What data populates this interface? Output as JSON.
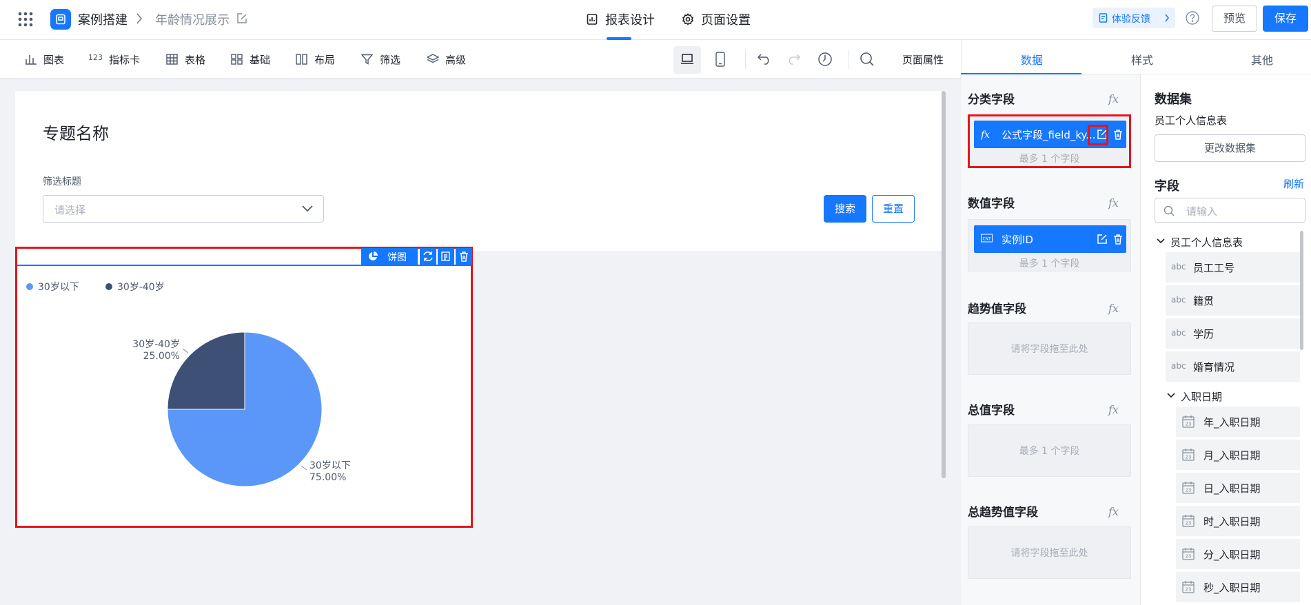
{
  "header": {
    "app_name": "案例搭建",
    "page_name": "年龄情况展示",
    "tabs": [
      {
        "label": "报表设计"
      },
      {
        "label": "页面设置"
      }
    ],
    "feedback_label": "体验反馈",
    "preview_label": "预览",
    "save_label": "保存"
  },
  "toolbar": {
    "items": [
      {
        "label": "图表",
        "icon": "bar-chart-icon"
      },
      {
        "label": "指标卡",
        "icon": "metric-icon"
      },
      {
        "label": "表格",
        "icon": "table-icon"
      },
      {
        "label": "基础",
        "icon": "grid-icon"
      },
      {
        "label": "布局",
        "icon": "layout-icon"
      },
      {
        "label": "筛选",
        "icon": "filter-icon"
      },
      {
        "label": "高级",
        "icon": "layers-icon"
      }
    ],
    "metric_icon_text": "123",
    "page_props_label": "页面属性"
  },
  "canvas": {
    "page_title": "专题名称",
    "filter_label": "筛选标题",
    "filter_placeholder": "请选择",
    "search_label": "搜索",
    "reset_label": "重置",
    "chart_badge": "饼图"
  },
  "chart_data": {
    "type": "pie",
    "title": "",
    "legend": "top-left",
    "series": [
      {
        "name": "30岁以下",
        "value": 75.0,
        "label": "75.00%",
        "color": "#5b97f9"
      },
      {
        "name": "30岁-40岁",
        "value": 25.0,
        "label": "25.00%",
        "color": "#3f5077"
      }
    ]
  },
  "config": {
    "tabs": [
      {
        "label": "数据"
      },
      {
        "label": "样式"
      },
      {
        "label": "其他"
      }
    ],
    "sections": {
      "category": {
        "title": "分类字段",
        "chip": "公式字段_field_ky...",
        "hint": "最多 1 个字段"
      },
      "value": {
        "title": "数值字段",
        "chip": "实例ID",
        "chip_type": "CNT",
        "hint": "最多 1 个字段"
      },
      "trend": {
        "title": "趋势值字段",
        "hint": "请将字段拖至此处"
      },
      "total": {
        "title": "总值字段",
        "hint": "最多 1 个字段"
      },
      "total_trend": {
        "title": "总趋势值字段",
        "hint": "请将字段拖至此处"
      }
    },
    "fx_label": "fx"
  },
  "dataset": {
    "title": "数据集",
    "name": "员工个人信息表",
    "change_label": "更改数据集",
    "fields_title": "字段",
    "refresh_label": "刷新",
    "search_placeholder": "请输入",
    "table_node": "员工个人信息表",
    "fields": [
      {
        "type": "abc",
        "label": "员工工号"
      },
      {
        "type": "abc",
        "label": "籍贯"
      },
      {
        "type": "abc",
        "label": "学历"
      },
      {
        "type": "abc",
        "label": "婚育情况"
      }
    ],
    "date_node": "入职日期",
    "date_fields": [
      {
        "label": "年_入职日期"
      },
      {
        "label": "月_入职日期"
      },
      {
        "label": "日_入职日期"
      },
      {
        "label": "时_入职日期"
      },
      {
        "label": "分_入职日期"
      },
      {
        "label": "秒_入职日期"
      }
    ]
  }
}
